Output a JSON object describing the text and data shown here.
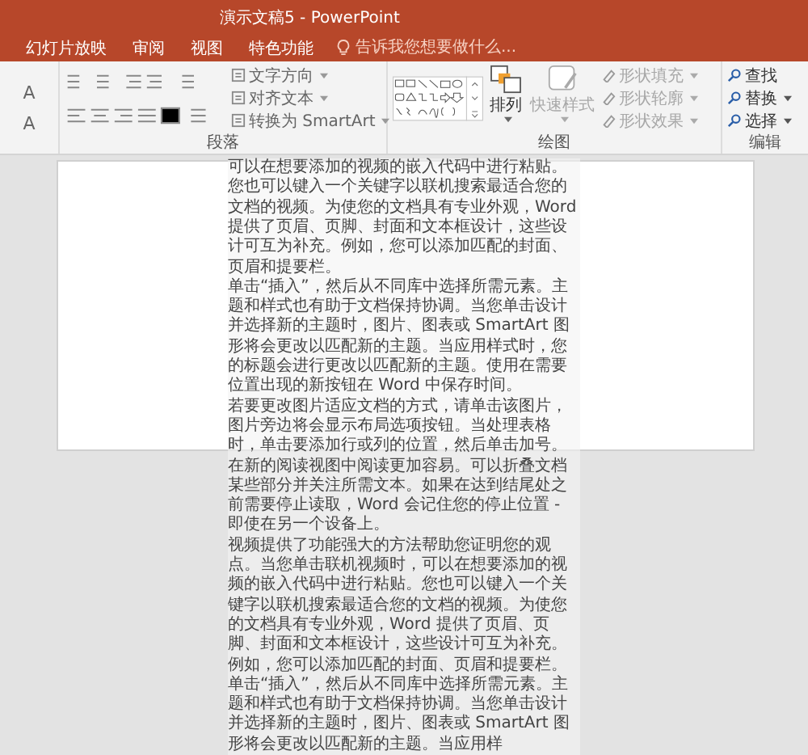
{
  "window": {
    "title": "演示文稿5 - PowerPoint"
  },
  "tabs": [
    {
      "label": "幻灯片放映",
      "selected": false
    },
    {
      "label": "审阅",
      "selected": false
    },
    {
      "label": "视图",
      "selected": false
    },
    {
      "label": "特色功能",
      "selected": false
    }
  ],
  "tell_me": {
    "placeholder": "告诉我您想要做什么..."
  },
  "font_group": {
    "grow_font": "A",
    "font_color": "A"
  },
  "paragraph_group": {
    "label": "段落",
    "commands": [
      {
        "label": "文字方向"
      },
      {
        "label": "对齐文本"
      },
      {
        "label": "转换为 SmartArt"
      }
    ]
  },
  "drawing_group": {
    "label": "绘图",
    "arrange": "排列",
    "quick_styles": {
      "label": "快速样式",
      "disabled": true
    },
    "format_commands": [
      {
        "label": "形状填充",
        "disabled": true
      },
      {
        "label": "形状轮廓",
        "disabled": true
      },
      {
        "label": "形状效果",
        "disabled": true
      }
    ]
  },
  "editing_group": {
    "label": "编辑",
    "commands": [
      {
        "label": "查找",
        "dropdown": false
      },
      {
        "label": "替换",
        "dropdown": true
      },
      {
        "label": "选择",
        "dropdown": true
      }
    ]
  },
  "document": {
    "paragraphs": [
      "可以在想要添加的视频的嵌入代码中进行粘贴。您也可以键入一个关键字以联机搜索最适合您的文档的视频。为使您的文档具有专业外观，Word 提供了页眉、页脚、封面和文本框设计，这些设计可互为补充。例如，您可以添加匹配的封面、页眉和提要栏。",
      "单击“插入”，然后从不同库中选择所需元素。主题和样式也有助于文档保持协调。当您单击设计并选择新的主题时，图片、图表或 SmartArt 图形将会更改以匹配新的主题。当应用样式时，您的标题会进行更改以匹配新的主题。使用在需要位置出现的新按钮在 Word 中保存时间。",
      "若要更改图片适应文档的方式，请单击该图片，图片旁边将会显示布局选项按钮。当处理表格时，单击要添加行或列的位置，然后单击加号。在新的阅读视图中阅读更加容易。可以折叠文档某些部分并关注所需文本。如果在达到结尾处之前需要停止读取，Word 会记住您的停止位置 - 即使在另一个设备上。",
      "视频提供了功能强大的方法帮助您证明您的观点。当您单击联机视频时，可以在想要添加的视频的嵌入代码中进行粘贴。您也可以键入一个关键字以联机搜索最适合您的文档的视频。为使您的文档具有专业外观，Word 提供了页眉、页脚、封面和文本框设计，这些设计可互为补充。例如，您可以添加匹配的封面、页眉和提要栏。",
      "单击“插入”，然后从不同库中选择所需元素。主题和样式也有助于文档保持协调。当您单击设计并选择新的主题时，图片、图表或 SmartArt 图形将会更改以匹配新的主题。当应用样"
    ]
  }
}
